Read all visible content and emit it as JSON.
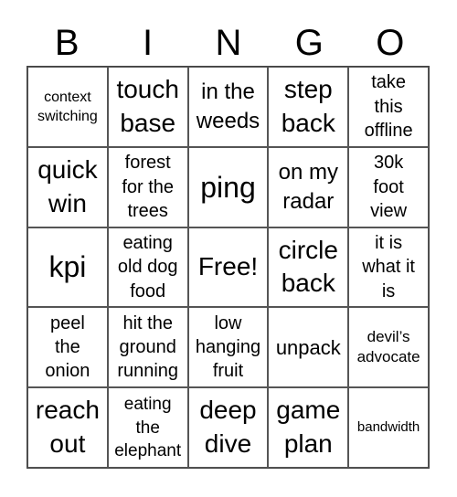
{
  "header": {
    "letters": [
      "B",
      "I",
      "N",
      "G",
      "O"
    ]
  },
  "cells": [
    [
      "context switching",
      "touch base",
      "in the weeds",
      "step back",
      "take this offline"
    ],
    [
      "quick win",
      "forest for the trees",
      "ping",
      "on my radar",
      "30k foot view"
    ],
    [
      "kpi",
      "eating old dog food",
      "Free!",
      "circle back",
      "it is what it is"
    ],
    [
      "peel the onion",
      "hit the ground running",
      "low hanging fruit",
      "unpack",
      "devil’s advocate"
    ],
    [
      "reach out",
      "eating the elephant",
      "deep dive",
      "game plan",
      "bandwidth"
    ]
  ]
}
